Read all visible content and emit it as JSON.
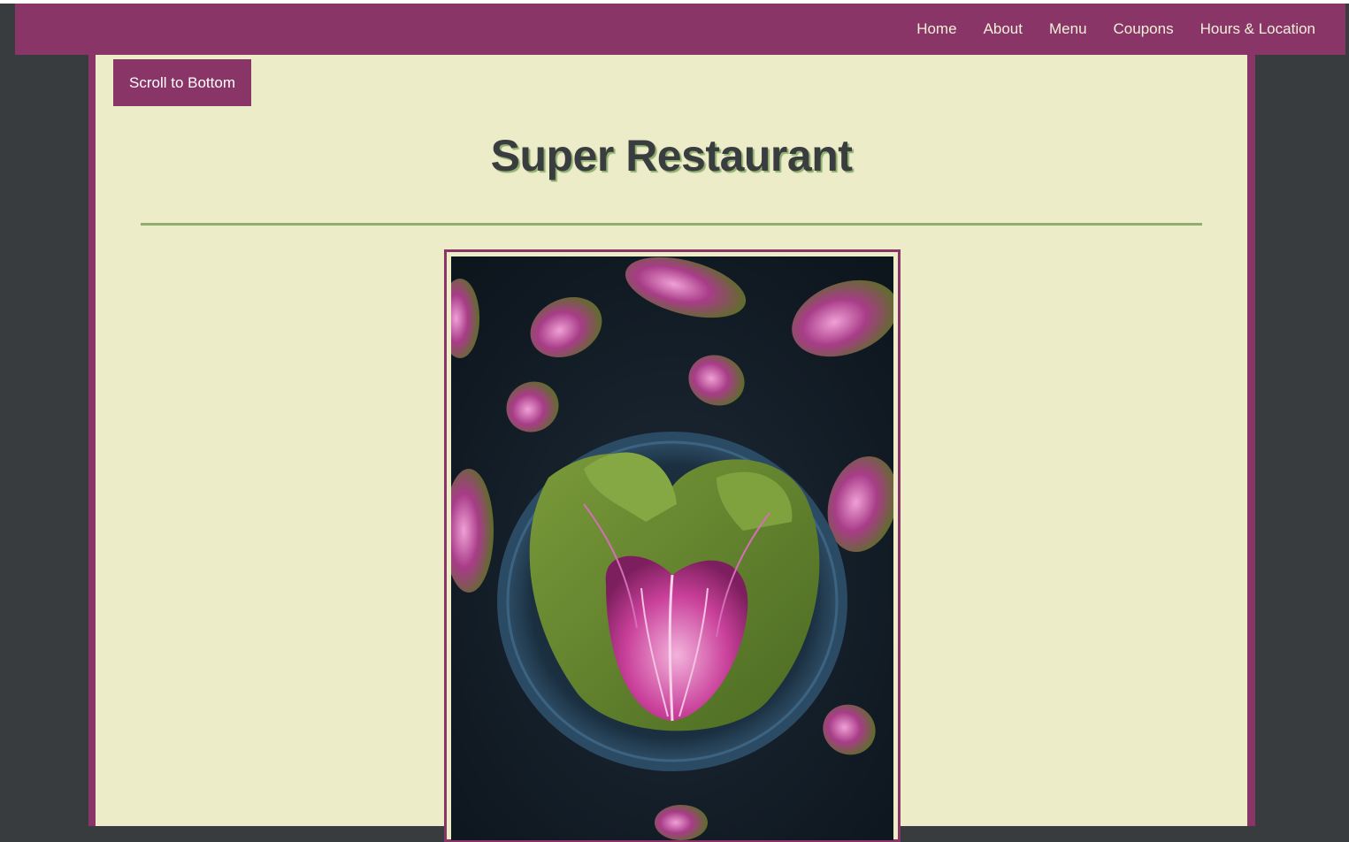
{
  "nav": {
    "links": [
      "Home",
      "About",
      "Menu",
      "Coupons",
      "Hours & Location"
    ]
  },
  "scroll_button": {
    "label": "Scroll to Bottom"
  },
  "title": "Super Restaurant",
  "hero_image": {
    "subject": "purple-green-cabbage-in-bowl"
  },
  "colors": {
    "brand": "#8a3567",
    "background": "#383c3f",
    "content": "#ecedc8",
    "accent": "#8fae6e",
    "title_text": "#3a3d3f"
  }
}
